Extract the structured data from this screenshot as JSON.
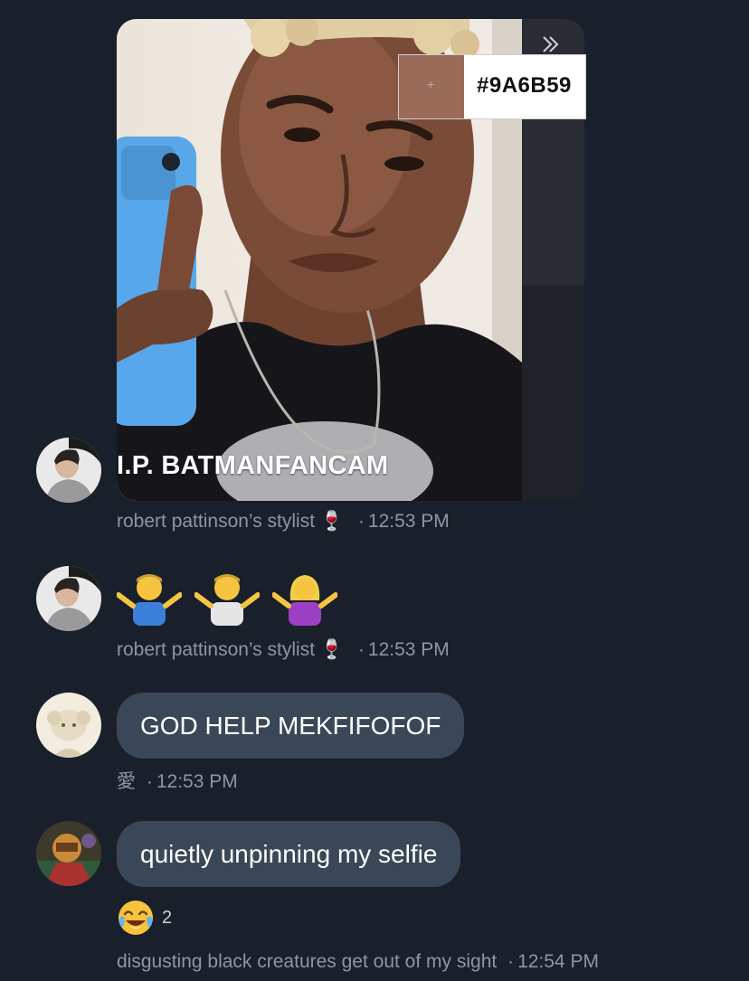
{
  "colors": {
    "background": "#19202b",
    "bubble": "#3a4757",
    "meta_text": "#8d96a3",
    "picked_color": "#9A6B59"
  },
  "media": {
    "color_picker_hex": "#9A6B59",
    "overlay_caption": "I.P. BATMANFANCAM",
    "forward_icon": "double-chevron-right-icon"
  },
  "messages": [
    {
      "author": "robert pattinson’s stylist",
      "author_emoji": "🍷",
      "time": "12:53 PM",
      "type": "image"
    },
    {
      "author": "robert pattinson’s stylist",
      "author_emoji": "🍷",
      "time": "12:53 PM",
      "type": "emoji",
      "emojis": [
        "🤷‍♂️",
        "🤷‍♂️",
        "🤷‍♀️"
      ]
    },
    {
      "author": "愛",
      "time": "12:53 PM",
      "type": "text",
      "text": "GOD HELP MEKFIFOFOF"
    },
    {
      "author": "disgusting black creatures get out of my sight",
      "time": "12:54 PM",
      "type": "text",
      "text": "quietly unpinning my selfie",
      "reaction": {
        "emoji": "😂",
        "count": "2"
      }
    }
  ]
}
